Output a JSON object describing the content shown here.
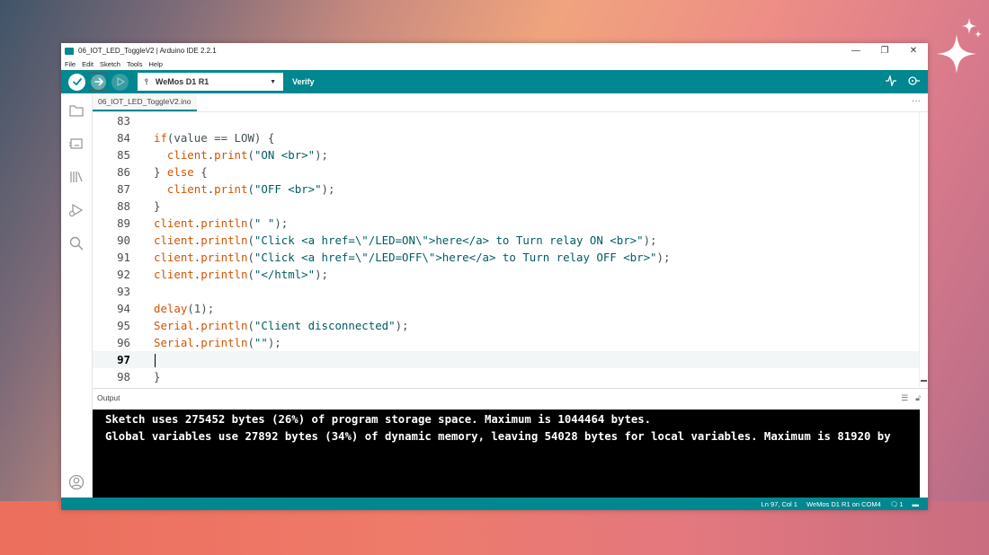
{
  "window": {
    "title": "06_IOT_LED_ToggleV2 | Arduino IDE 2.2.1",
    "minimize": "—",
    "maximize": "❐",
    "close": "✕"
  },
  "menu": [
    "File",
    "Edit",
    "Sketch",
    "Tools",
    "Help"
  ],
  "toolbar": {
    "board": "WeMos D1 R1",
    "hover_label": "Verify",
    "icons": [
      "verify-icon",
      "upload-icon",
      "debug-icon",
      "usb-icon",
      "serial-plotter-icon",
      "serial-monitor-icon"
    ]
  },
  "tab": {
    "filename": "06_IOT_LED_ToggleV2.ino",
    "more": "···"
  },
  "editor": {
    "lines": [
      {
        "n": "83",
        "segs": []
      },
      {
        "n": "84",
        "segs": [
          [
            "kw",
            "if"
          ],
          [
            "plain",
            "(value == LOW) {"
          ]
        ]
      },
      {
        "n": "85",
        "segs": [
          [
            "plain",
            "  "
          ],
          [
            "kw",
            "client"
          ],
          [
            "plain",
            "."
          ],
          [
            "kw",
            "print"
          ],
          [
            "plain",
            "("
          ],
          [
            "str",
            "\"ON <br>\""
          ],
          [
            "plain",
            ");"
          ]
        ]
      },
      {
        "n": "86",
        "segs": [
          [
            "plain",
            "} "
          ],
          [
            "kw",
            "else"
          ],
          [
            "plain",
            " {"
          ]
        ]
      },
      {
        "n": "87",
        "segs": [
          [
            "plain",
            "  "
          ],
          [
            "kw",
            "client"
          ],
          [
            "plain",
            "."
          ],
          [
            "kw",
            "print"
          ],
          [
            "plain",
            "("
          ],
          [
            "str",
            "\"OFF <br>\""
          ],
          [
            "plain",
            ");"
          ]
        ]
      },
      {
        "n": "88",
        "segs": [
          [
            "plain",
            "}"
          ]
        ]
      },
      {
        "n": "89",
        "segs": [
          [
            "kw",
            "client"
          ],
          [
            "plain",
            "."
          ],
          [
            "kw",
            "println"
          ],
          [
            "plain",
            "("
          ],
          [
            "str",
            "\" \""
          ],
          [
            "plain",
            ");"
          ]
        ]
      },
      {
        "n": "90",
        "segs": [
          [
            "kw",
            "client"
          ],
          [
            "plain",
            "."
          ],
          [
            "kw",
            "println"
          ],
          [
            "plain",
            "("
          ],
          [
            "str",
            "\"Click <a href=\\\"/LED=ON\\\">here</a> to Turn relay ON <br>\""
          ],
          [
            "plain",
            ");"
          ]
        ]
      },
      {
        "n": "91",
        "segs": [
          [
            "kw",
            "client"
          ],
          [
            "plain",
            "."
          ],
          [
            "kw",
            "println"
          ],
          [
            "plain",
            "("
          ],
          [
            "str",
            "\"Click <a href=\\\"/LED=OFF\\\">here</a> to Turn relay OFF <br>\""
          ],
          [
            "plain",
            ");"
          ]
        ]
      },
      {
        "n": "92",
        "segs": [
          [
            "kw",
            "client"
          ],
          [
            "plain",
            "."
          ],
          [
            "kw",
            "println"
          ],
          [
            "plain",
            "("
          ],
          [
            "str",
            "\"</html>\""
          ],
          [
            "plain",
            ");"
          ]
        ]
      },
      {
        "n": "93",
        "segs": []
      },
      {
        "n": "94",
        "segs": [
          [
            "kw",
            "delay"
          ],
          [
            "plain",
            "(1);"
          ]
        ]
      },
      {
        "n": "95",
        "segs": [
          [
            "kw",
            "Serial"
          ],
          [
            "plain",
            "."
          ],
          [
            "kw",
            "println"
          ],
          [
            "plain",
            "("
          ],
          [
            "str",
            "\"Client disconnected\""
          ],
          [
            "plain",
            ");"
          ]
        ]
      },
      {
        "n": "96",
        "segs": [
          [
            "kw",
            "Serial"
          ],
          [
            "plain",
            "."
          ],
          [
            "kw",
            "println"
          ],
          [
            "plain",
            "("
          ],
          [
            "str",
            "\"\""
          ],
          [
            "plain",
            ");"
          ]
        ]
      },
      {
        "n": "97",
        "segs": [],
        "current": true
      },
      {
        "n": "98",
        "segs": [
          [
            "plain",
            "}"
          ]
        ]
      }
    ]
  },
  "output": {
    "title": "Output",
    "lines": [
      "Sketch uses 275452 bytes (26%) of program storage space. Maximum is 1044464 bytes.",
      "Global variables use 27892 bytes (34%) of dynamic memory, leaving 54028 bytes for local variables. Maximum is 81920 by"
    ]
  },
  "status": {
    "position": "Ln 97, Col 1",
    "board_port": "WeMos D1 R1 on COM4",
    "notifications": "1",
    "close": "▬"
  },
  "colors": {
    "accent": "#00878f",
    "keyword": "#d35400",
    "string": "#005c5f"
  }
}
